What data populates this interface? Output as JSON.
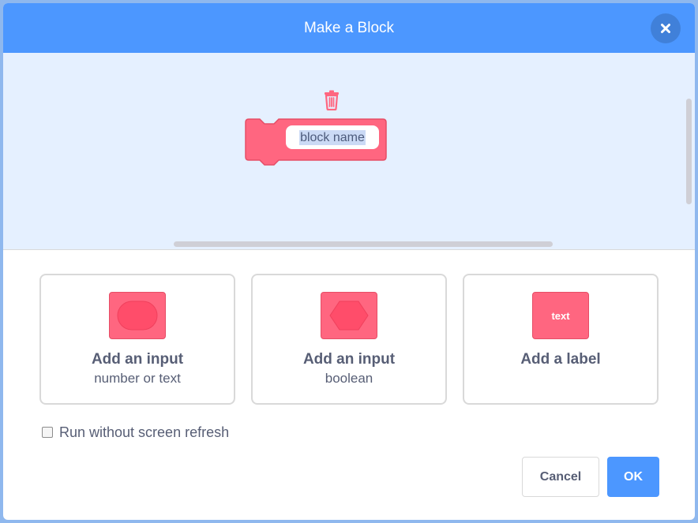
{
  "dialog": {
    "title": "Make a Block",
    "close_icon": "close-icon"
  },
  "workspace": {
    "block_name_value": "block name",
    "block_color": "#ff6680",
    "trash_icon": "trash-icon"
  },
  "options": [
    {
      "title": "Add an input",
      "subtitle": "number or text",
      "icon": "number-input-icon"
    },
    {
      "title": "Add an input",
      "subtitle": "boolean",
      "icon": "boolean-input-icon"
    },
    {
      "title": "Add a label",
      "subtitle": "",
      "icon": "label-icon",
      "swatch_text": "text"
    }
  ],
  "refresh": {
    "label": "Run without screen refresh",
    "checked": false
  },
  "buttons": {
    "cancel": "Cancel",
    "ok": "OK"
  },
  "colors": {
    "header": "#4c97ff",
    "workspace_bg": "#e5f0ff",
    "block": "#ff6680",
    "text": "#575e75"
  }
}
